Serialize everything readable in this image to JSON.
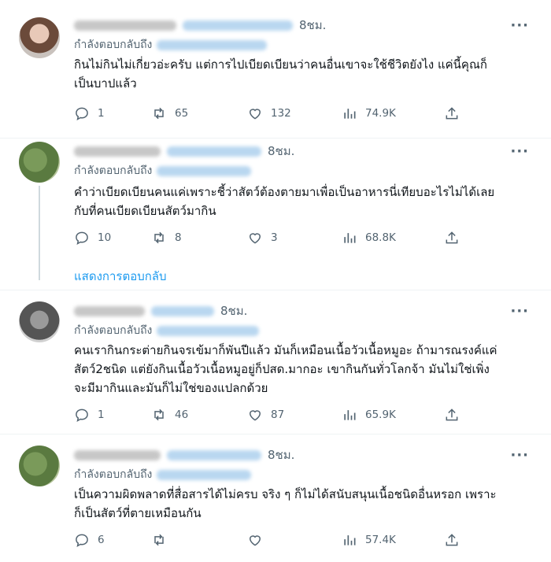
{
  "show_replies_label": "แสดงการตอบกลับ",
  "tweets": [
    {
      "time": "8ชม.",
      "reply_label": "กำลังตอบกลับถึง",
      "text": "กินไม่กินไม่เกี่ยวอ่ะครับ แต่การไปเบียดเบียนว่าคนอื่นเขาจะใช้ชีวิตยังไง แค่นี้คุณก็\nเป็นบาปแล้ว",
      "replies": "1",
      "retweets": "65",
      "likes": "132",
      "views": "74.9K"
    },
    {
      "time": "8ชม.",
      "reply_label": "กำลังตอบกลับถึง",
      "text": "คำว่าเบียดเบียนคนแค่เพราะชี้ว่าสัตว์ต้องตายมาเพื่อเป็นอาหารนี่เทียบอะไรไม่ได้เลย\nกับที่คนเบียดเบียนสัตว์มากิน",
      "replies": "10",
      "retweets": "8",
      "likes": "3",
      "views": "68.8K"
    },
    {
      "time": "8ชม.",
      "reply_label": "กำลังตอบกลับถึง",
      "text": "คนเรากินกระต่ายกินจรเข้มาก็พันปีแล้ว มันก็เหมือนเนื้อวัวเนื้อหมูอะ ถ้ามารณรงค์แค่\nสัตว์2ชนิด แต่ยังกินเนื้อวัวเนื้อหมูอยู่ก็ปสด.มากอะ เขากินกันทั่วโลกจ้า มันไม่ใช่เพิ่ง\nจะมีมากินและมันก็ไม่ใช่ของแปลกด้วย",
      "replies": "1",
      "retweets": "46",
      "likes": "87",
      "views": "65.9K"
    },
    {
      "time": "8ชม.",
      "reply_label": "กำลังตอบกลับถึง",
      "text": "เป็นความผิดพลาดที่สื่อสารได้ไม่ครบ จริง ๆ ก็ไม่ได้สนับสนุนเนื้อชนิดอื่นหรอก เพราะ\nก็เป็นสัตว์ที่ตายเหมือนกัน",
      "replies": "6",
      "retweets": "",
      "likes": "",
      "views": "57.4K"
    }
  ],
  "icons": [
    "reply-icon",
    "retweet-icon",
    "like-icon",
    "views-icon",
    "share-icon",
    "more-icon"
  ]
}
